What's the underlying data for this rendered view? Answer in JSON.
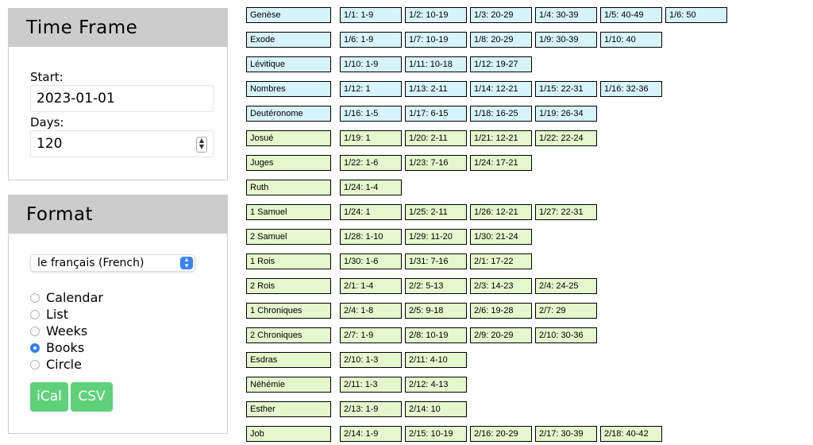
{
  "time_frame": {
    "title": "Time Frame",
    "start_label": "Start:",
    "start_value": "2023-01-01",
    "days_label": "Days:",
    "days_value": "120"
  },
  "format": {
    "title": "Format",
    "language": "le français (French)",
    "options": [
      "Calendar",
      "List",
      "Weeks",
      "Books",
      "Circle"
    ],
    "selected": "Books",
    "buttons": {
      "ical": "iCal",
      "csv": "CSV"
    },
    "button_color": "#5fd17a"
  },
  "colors": {
    "law": "#d7f3fb",
    "history": "#e5f7cd"
  },
  "books": [
    {
      "name": "Genèse",
      "group": "law",
      "readings": [
        "1/1: 1-9",
        "1/2: 10-19",
        "1/3: 20-29",
        "1/4: 30-39",
        "1/5: 40-49",
        "1/6: 50"
      ]
    },
    {
      "name": "Exode",
      "group": "law",
      "readings": [
        "1/6: 1-9",
        "1/7: 10-19",
        "1/8: 20-29",
        "1/9: 30-39",
        "1/10: 40"
      ]
    },
    {
      "name": "Lévitique",
      "group": "law",
      "readings": [
        "1/10: 1-9",
        "1/11: 10-18",
        "1/12: 19-27"
      ]
    },
    {
      "name": "Nombres",
      "group": "law",
      "readings": [
        "1/12: 1",
        "1/13: 2-11",
        "1/14: 12-21",
        "1/15: 22-31",
        "1/16: 32-36"
      ]
    },
    {
      "name": "Deutéronome",
      "group": "law",
      "readings": [
        "1/16: 1-5",
        "1/17: 6-15",
        "1/18: 16-25",
        "1/19: 26-34"
      ]
    },
    {
      "name": "Josué",
      "group": "history",
      "readings": [
        "1/19: 1",
        "1/20: 2-11",
        "1/21: 12-21",
        "1/22: 22-24"
      ]
    },
    {
      "name": "Juges",
      "group": "history",
      "readings": [
        "1/22: 1-6",
        "1/23: 7-16",
        "1/24: 17-21"
      ]
    },
    {
      "name": "Ruth",
      "group": "history",
      "readings": [
        "1/24: 1-4"
      ]
    },
    {
      "name": "1 Samuel",
      "group": "history",
      "readings": [
        "1/24: 1",
        "1/25: 2-11",
        "1/26: 12-21",
        "1/27: 22-31"
      ]
    },
    {
      "name": "2 Samuel",
      "group": "history",
      "readings": [
        "1/28: 1-10",
        "1/29: 11-20",
        "1/30: 21-24"
      ]
    },
    {
      "name": "1 Rois",
      "group": "history",
      "readings": [
        "1/30: 1-6",
        "1/31: 7-16",
        "2/1: 17-22"
      ]
    },
    {
      "name": "2 Rois",
      "group": "history",
      "readings": [
        "2/1: 1-4",
        "2/2: 5-13",
        "2/3: 14-23",
        "2/4: 24-25"
      ]
    },
    {
      "name": "1 Chroniques",
      "group": "history",
      "readings": [
        "2/4: 1-8",
        "2/5: 9-18",
        "2/6: 19-28",
        "2/7: 29"
      ]
    },
    {
      "name": "2 Chroniques",
      "group": "history",
      "readings": [
        "2/7: 1-9",
        "2/8: 10-19",
        "2/9: 20-29",
        "2/10: 30-36"
      ]
    },
    {
      "name": "Esdras",
      "group": "history",
      "readings": [
        "2/10: 1-3",
        "2/11: 4-10"
      ]
    },
    {
      "name": "Néhémie",
      "group": "history",
      "readings": [
        "2/11: 1-3",
        "2/12: 4-13"
      ]
    },
    {
      "name": "Esther",
      "group": "history",
      "readings": [
        "2/13: 1-9",
        "2/14: 10"
      ]
    },
    {
      "name": "Job",
      "group": "history",
      "readings": [
        "2/14: 1-9",
        "2/15: 10-19",
        "2/16: 20-29",
        "2/17: 30-39",
        "2/18: 40-42"
      ]
    }
  ]
}
